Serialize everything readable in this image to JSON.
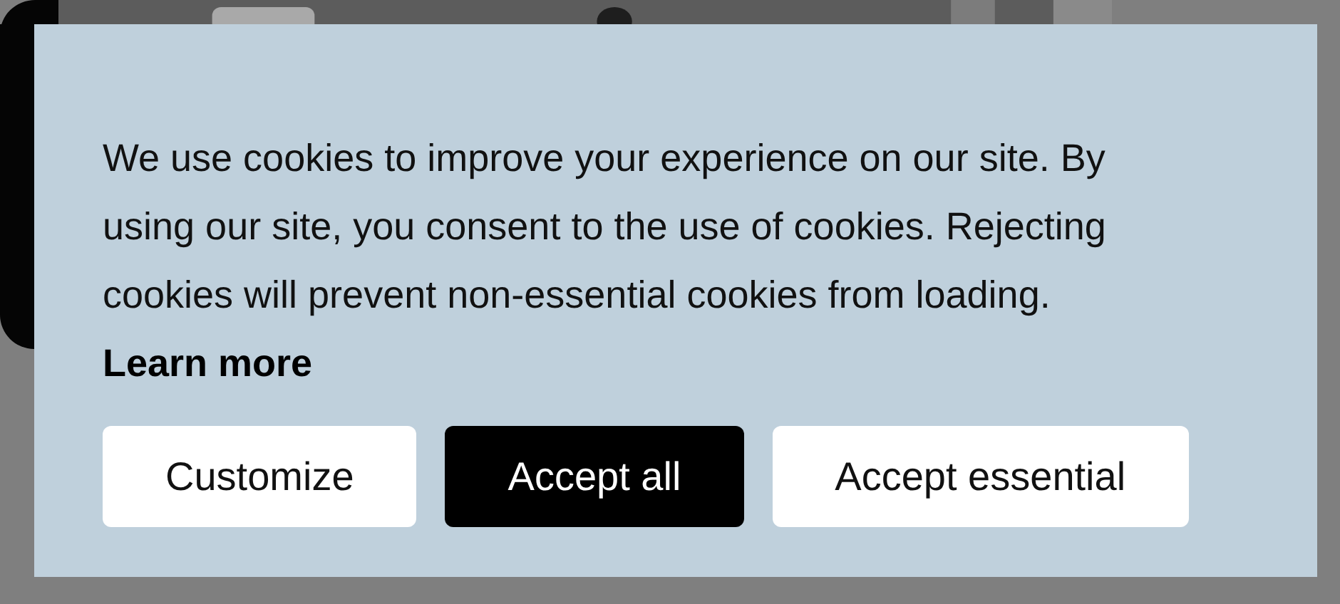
{
  "banner": {
    "message": "We use cookies to improve your experience on our site. By using our site, you consent to the use of cookies. Rejecting cookies will prevent non-essential cookies from loading.",
    "link": "Learn more",
    "buttons": [
      {
        "label": "Customize",
        "kind": "secondary"
      },
      {
        "label": "Accept all",
        "kind": "primary"
      },
      {
        "label": "Accept essential",
        "kind": "secondary"
      }
    ]
  }
}
